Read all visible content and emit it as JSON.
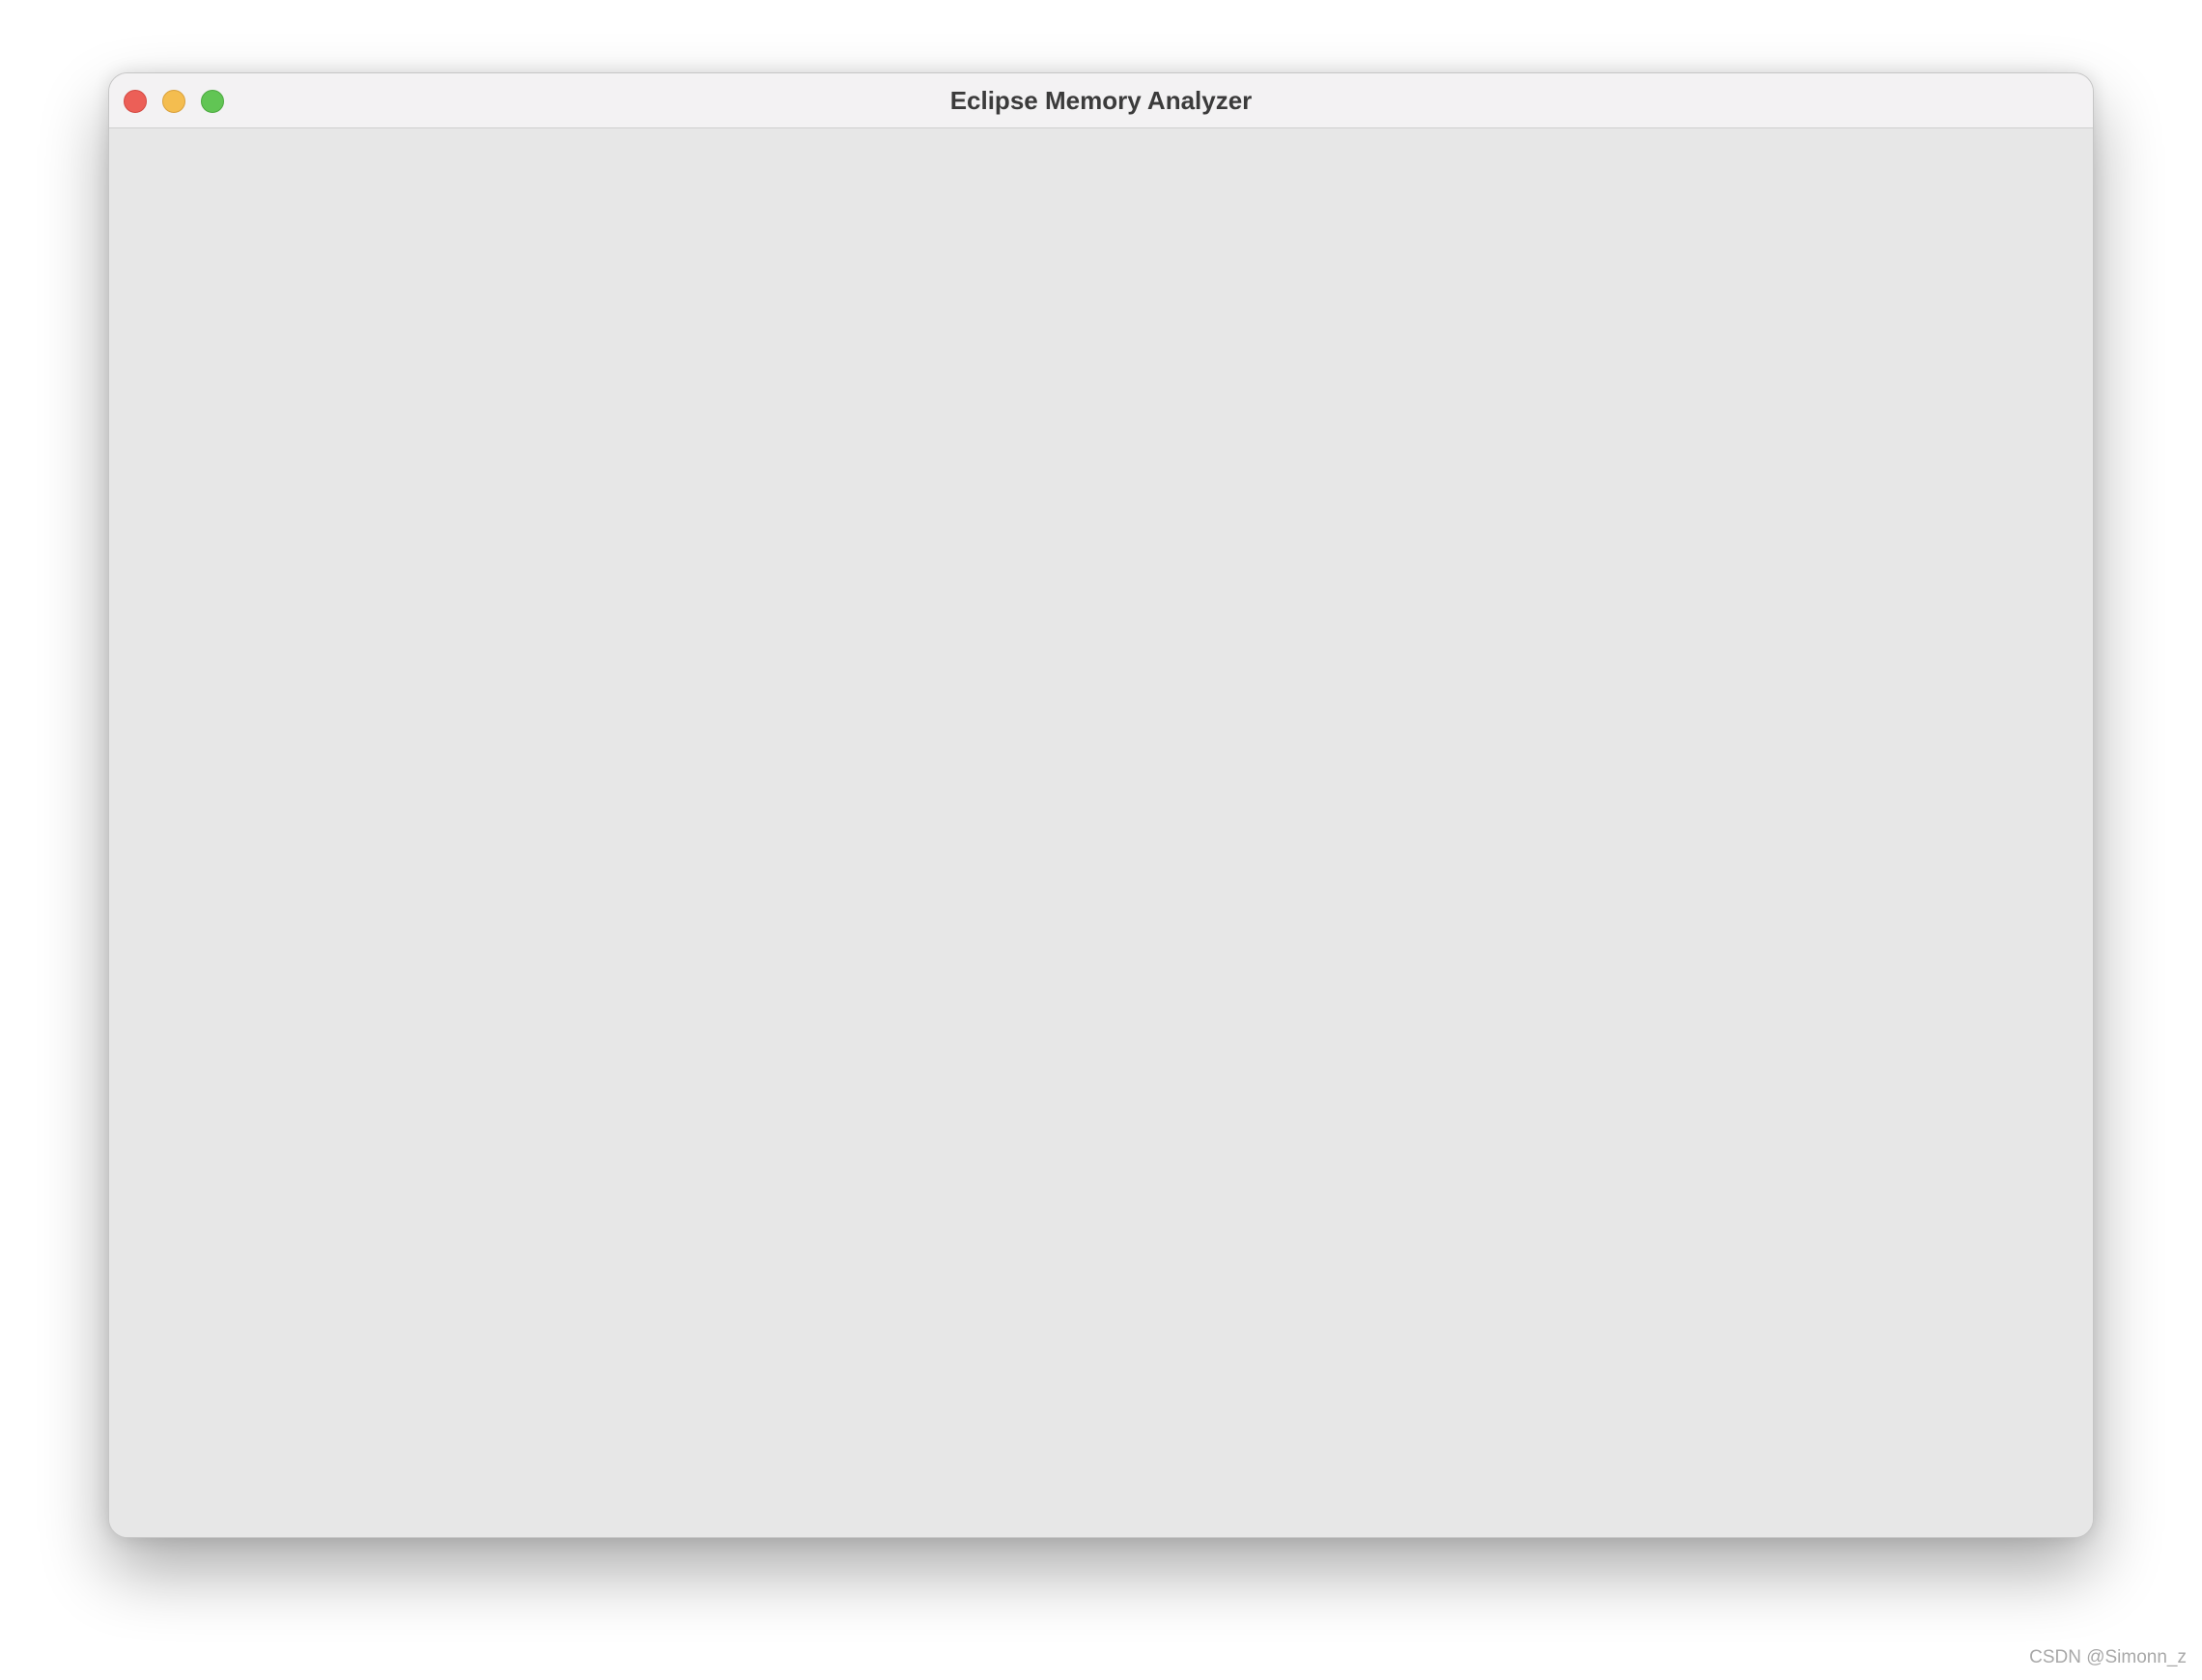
{
  "window": {
    "title": "Eclipse Memory Analyzer",
    "controls": {
      "close_icon": "close-traffic-light",
      "minimize_icon": "minimize-traffic-light",
      "zoom_icon": "zoom-traffic-light"
    },
    "colors": {
      "close": "#ec5f57",
      "minimize": "#f4bd4f",
      "zoom": "#61c554",
      "content_background": "#e7e7e7",
      "titlebar_background": "#f3f2f3"
    }
  },
  "watermark": {
    "text": "CSDN @Simonn_z"
  }
}
